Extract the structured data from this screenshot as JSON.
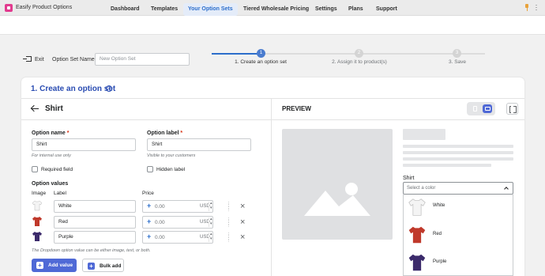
{
  "app": {
    "title": "Easify Product Options"
  },
  "nav": {
    "items": [
      "Dashboard",
      "Templates",
      "Your Option Sets",
      "Tiered Wholesale Pricing",
      "Settings",
      "Plans",
      "Support"
    ],
    "active_index": 2
  },
  "option_set": {
    "exit_label": "Exit",
    "name_label": "Option Set Name",
    "name_placeholder": "New Option Set"
  },
  "stepper": {
    "steps": [
      {
        "number": "1",
        "label": "1. Create an option set",
        "state": "active"
      },
      {
        "number": "2",
        "label": "2. Assign it to product(s)",
        "state": "inactive"
      },
      {
        "number": "3",
        "label": "3. Save",
        "state": "inactive"
      }
    ]
  },
  "card": {
    "title": "1. Create an option set",
    "help_icon": "question-circle-icon"
  },
  "editor": {
    "option_title": "Shirt",
    "option_name": {
      "label": "Option name",
      "required_mark": "*",
      "value": "Shirt",
      "helper": "For internal use only"
    },
    "option_label": {
      "label": "Option label",
      "required_mark": "*",
      "value": "Shirt",
      "helper": "Visible to your customers"
    },
    "required_field": {
      "label": "Required field",
      "checked": false
    },
    "hidden_label": {
      "label": "Hidden label",
      "checked": false
    },
    "values_title": "Option values",
    "columns": {
      "image": "Image",
      "label": "Label",
      "price": "Price"
    },
    "rows": [
      {
        "label": "White",
        "price": "0.00",
        "currency": "USD",
        "color": "#f4f4f4"
      },
      {
        "label": "Red",
        "price": "0.00",
        "currency": "USD",
        "color": "#c0392b"
      },
      {
        "label": "Purple",
        "price": "0.00",
        "currency": "USD",
        "color": "#3b2a6b"
      }
    ],
    "hint": "The Dropdown option value can be either image, text, or both.",
    "add_value_label": "Add value",
    "bulk_add_label": "Bulk add"
  },
  "preview": {
    "title": "PREVIEW",
    "select_label": "Shirt",
    "select_placeholder": "Select a color",
    "options": [
      {
        "label": "White",
        "color": "#f4f4f4"
      },
      {
        "label": "Red",
        "color": "#c0392b"
      },
      {
        "label": "Purple",
        "color": "#3b2a6b"
      }
    ]
  },
  "colors": {
    "accent": "#2c6ecb",
    "title_blue": "#2a4cb2",
    "primary_button": "#4f69d6"
  }
}
